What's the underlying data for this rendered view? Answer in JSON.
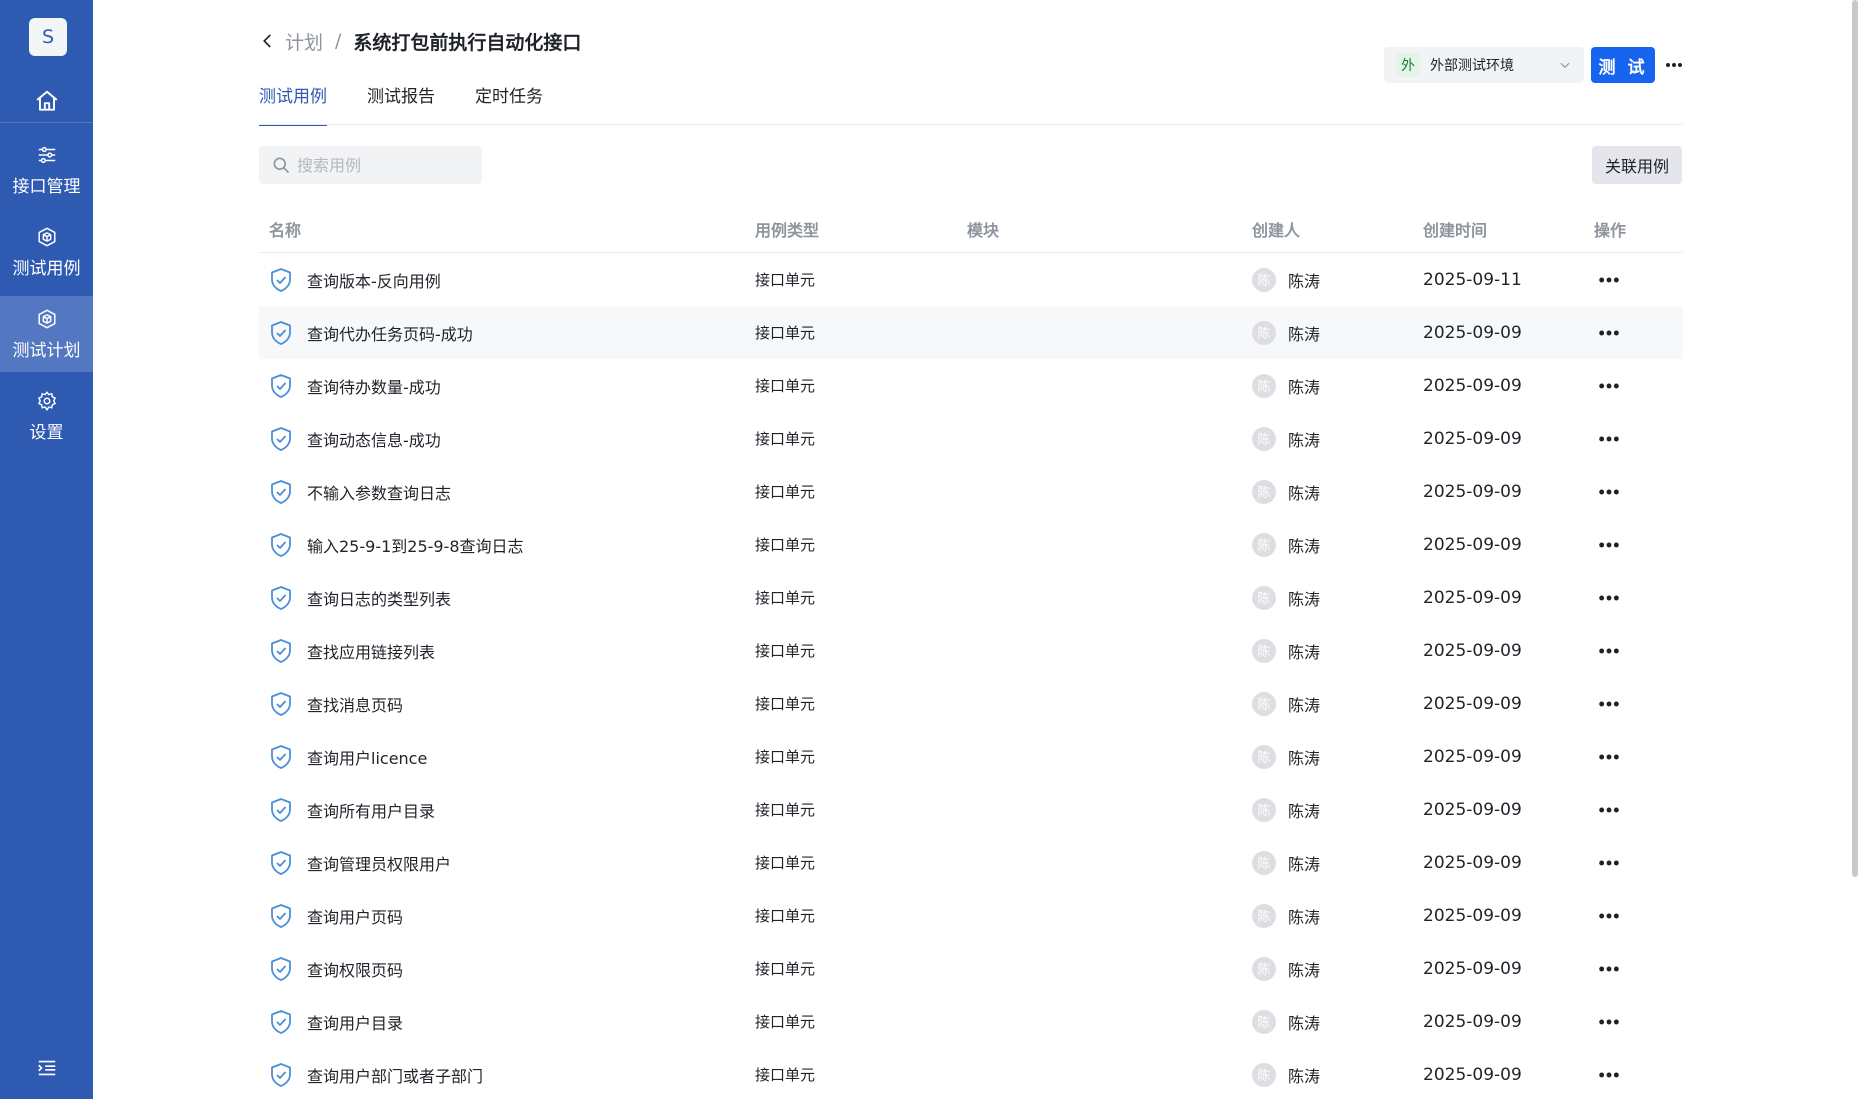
{
  "sidebar": {
    "avatar_letter": "S",
    "items": [
      {
        "label": "接口管理",
        "icon": "sliders-icon"
      },
      {
        "label": "测试用例",
        "icon": "cube-icon"
      },
      {
        "label": "测试计划",
        "icon": "cube-icon",
        "active": true
      },
      {
        "label": "设置",
        "icon": "gear-icon"
      }
    ]
  },
  "breadcrumb": {
    "parent": "计划",
    "separator": "/",
    "current": "系统打包前执行自动化接口"
  },
  "tabs": [
    {
      "label": "测试用例",
      "active": true
    },
    {
      "label": "测试报告"
    },
    {
      "label": "定时任务"
    }
  ],
  "environment": {
    "badge": "外",
    "label": "外部测试环境"
  },
  "test_button": "测 试",
  "search": {
    "placeholder": "搜索用例",
    "value": ""
  },
  "link_case_button": "关联用例",
  "table": {
    "columns": [
      "名称",
      "用例类型",
      "模块",
      "创建人",
      "创建时间",
      "操作"
    ],
    "rows": [
      {
        "name": "查询版本-反向用例",
        "type": "接口单元",
        "module": "",
        "creator_initial": "陈",
        "creator": "陈涛",
        "created": "2025-09-11"
      },
      {
        "name": "查询代办任务页码-成功",
        "type": "接口单元",
        "module": "",
        "creator_initial": "陈",
        "creator": "陈涛",
        "created": "2025-09-09"
      },
      {
        "name": "查询待办数量-成功",
        "type": "接口单元",
        "module": "",
        "creator_initial": "陈",
        "creator": "陈涛",
        "created": "2025-09-09"
      },
      {
        "name": "查询动态信息-成功",
        "type": "接口单元",
        "module": "",
        "creator_initial": "陈",
        "creator": "陈涛",
        "created": "2025-09-09"
      },
      {
        "name": "不输入参数查询日志",
        "type": "接口单元",
        "module": "",
        "creator_initial": "陈",
        "creator": "陈涛",
        "created": "2025-09-09"
      },
      {
        "name": "输入25-9-1到25-9-8查询日志",
        "type": "接口单元",
        "module": "",
        "creator_initial": "陈",
        "creator": "陈涛",
        "created": "2025-09-09"
      },
      {
        "name": "查询日志的类型列表",
        "type": "接口单元",
        "module": "",
        "creator_initial": "陈",
        "creator": "陈涛",
        "created": "2025-09-09"
      },
      {
        "name": "查找应用链接列表",
        "type": "接口单元",
        "module": "",
        "creator_initial": "陈",
        "creator": "陈涛",
        "created": "2025-09-09"
      },
      {
        "name": "查找消息页码",
        "type": "接口单元",
        "module": "",
        "creator_initial": "陈",
        "creator": "陈涛",
        "created": "2025-09-09"
      },
      {
        "name": "查询用户licence",
        "type": "接口单元",
        "module": "",
        "creator_initial": "陈",
        "creator": "陈涛",
        "created": "2025-09-09"
      },
      {
        "name": "查询所有用户目录",
        "type": "接口单元",
        "module": "",
        "creator_initial": "陈",
        "creator": "陈涛",
        "created": "2025-09-09"
      },
      {
        "name": "查询管理员权限用户",
        "type": "接口单元",
        "module": "",
        "creator_initial": "陈",
        "creator": "陈涛",
        "created": "2025-09-09"
      },
      {
        "name": "查询用户页码",
        "type": "接口单元",
        "module": "",
        "creator_initial": "陈",
        "creator": "陈涛",
        "created": "2025-09-09"
      },
      {
        "name": "查询权限页码",
        "type": "接口单元",
        "module": "",
        "creator_initial": "陈",
        "creator": "陈涛",
        "created": "2025-09-09"
      },
      {
        "name": "查询用户目录",
        "type": "接口单元",
        "module": "",
        "creator_initial": "陈",
        "creator": "陈涛",
        "created": "2025-09-09"
      },
      {
        "name": "查询用户部门或者子部门",
        "type": "接口单元",
        "module": "",
        "creator_initial": "陈",
        "creator": "陈涛",
        "created": "2025-09-09"
      }
    ]
  },
  "colors": {
    "sidebar": "#2e5ab1",
    "sidebar_active": "#5378c1",
    "primary": "#1764ee",
    "shield": "#4a8fd8"
  }
}
